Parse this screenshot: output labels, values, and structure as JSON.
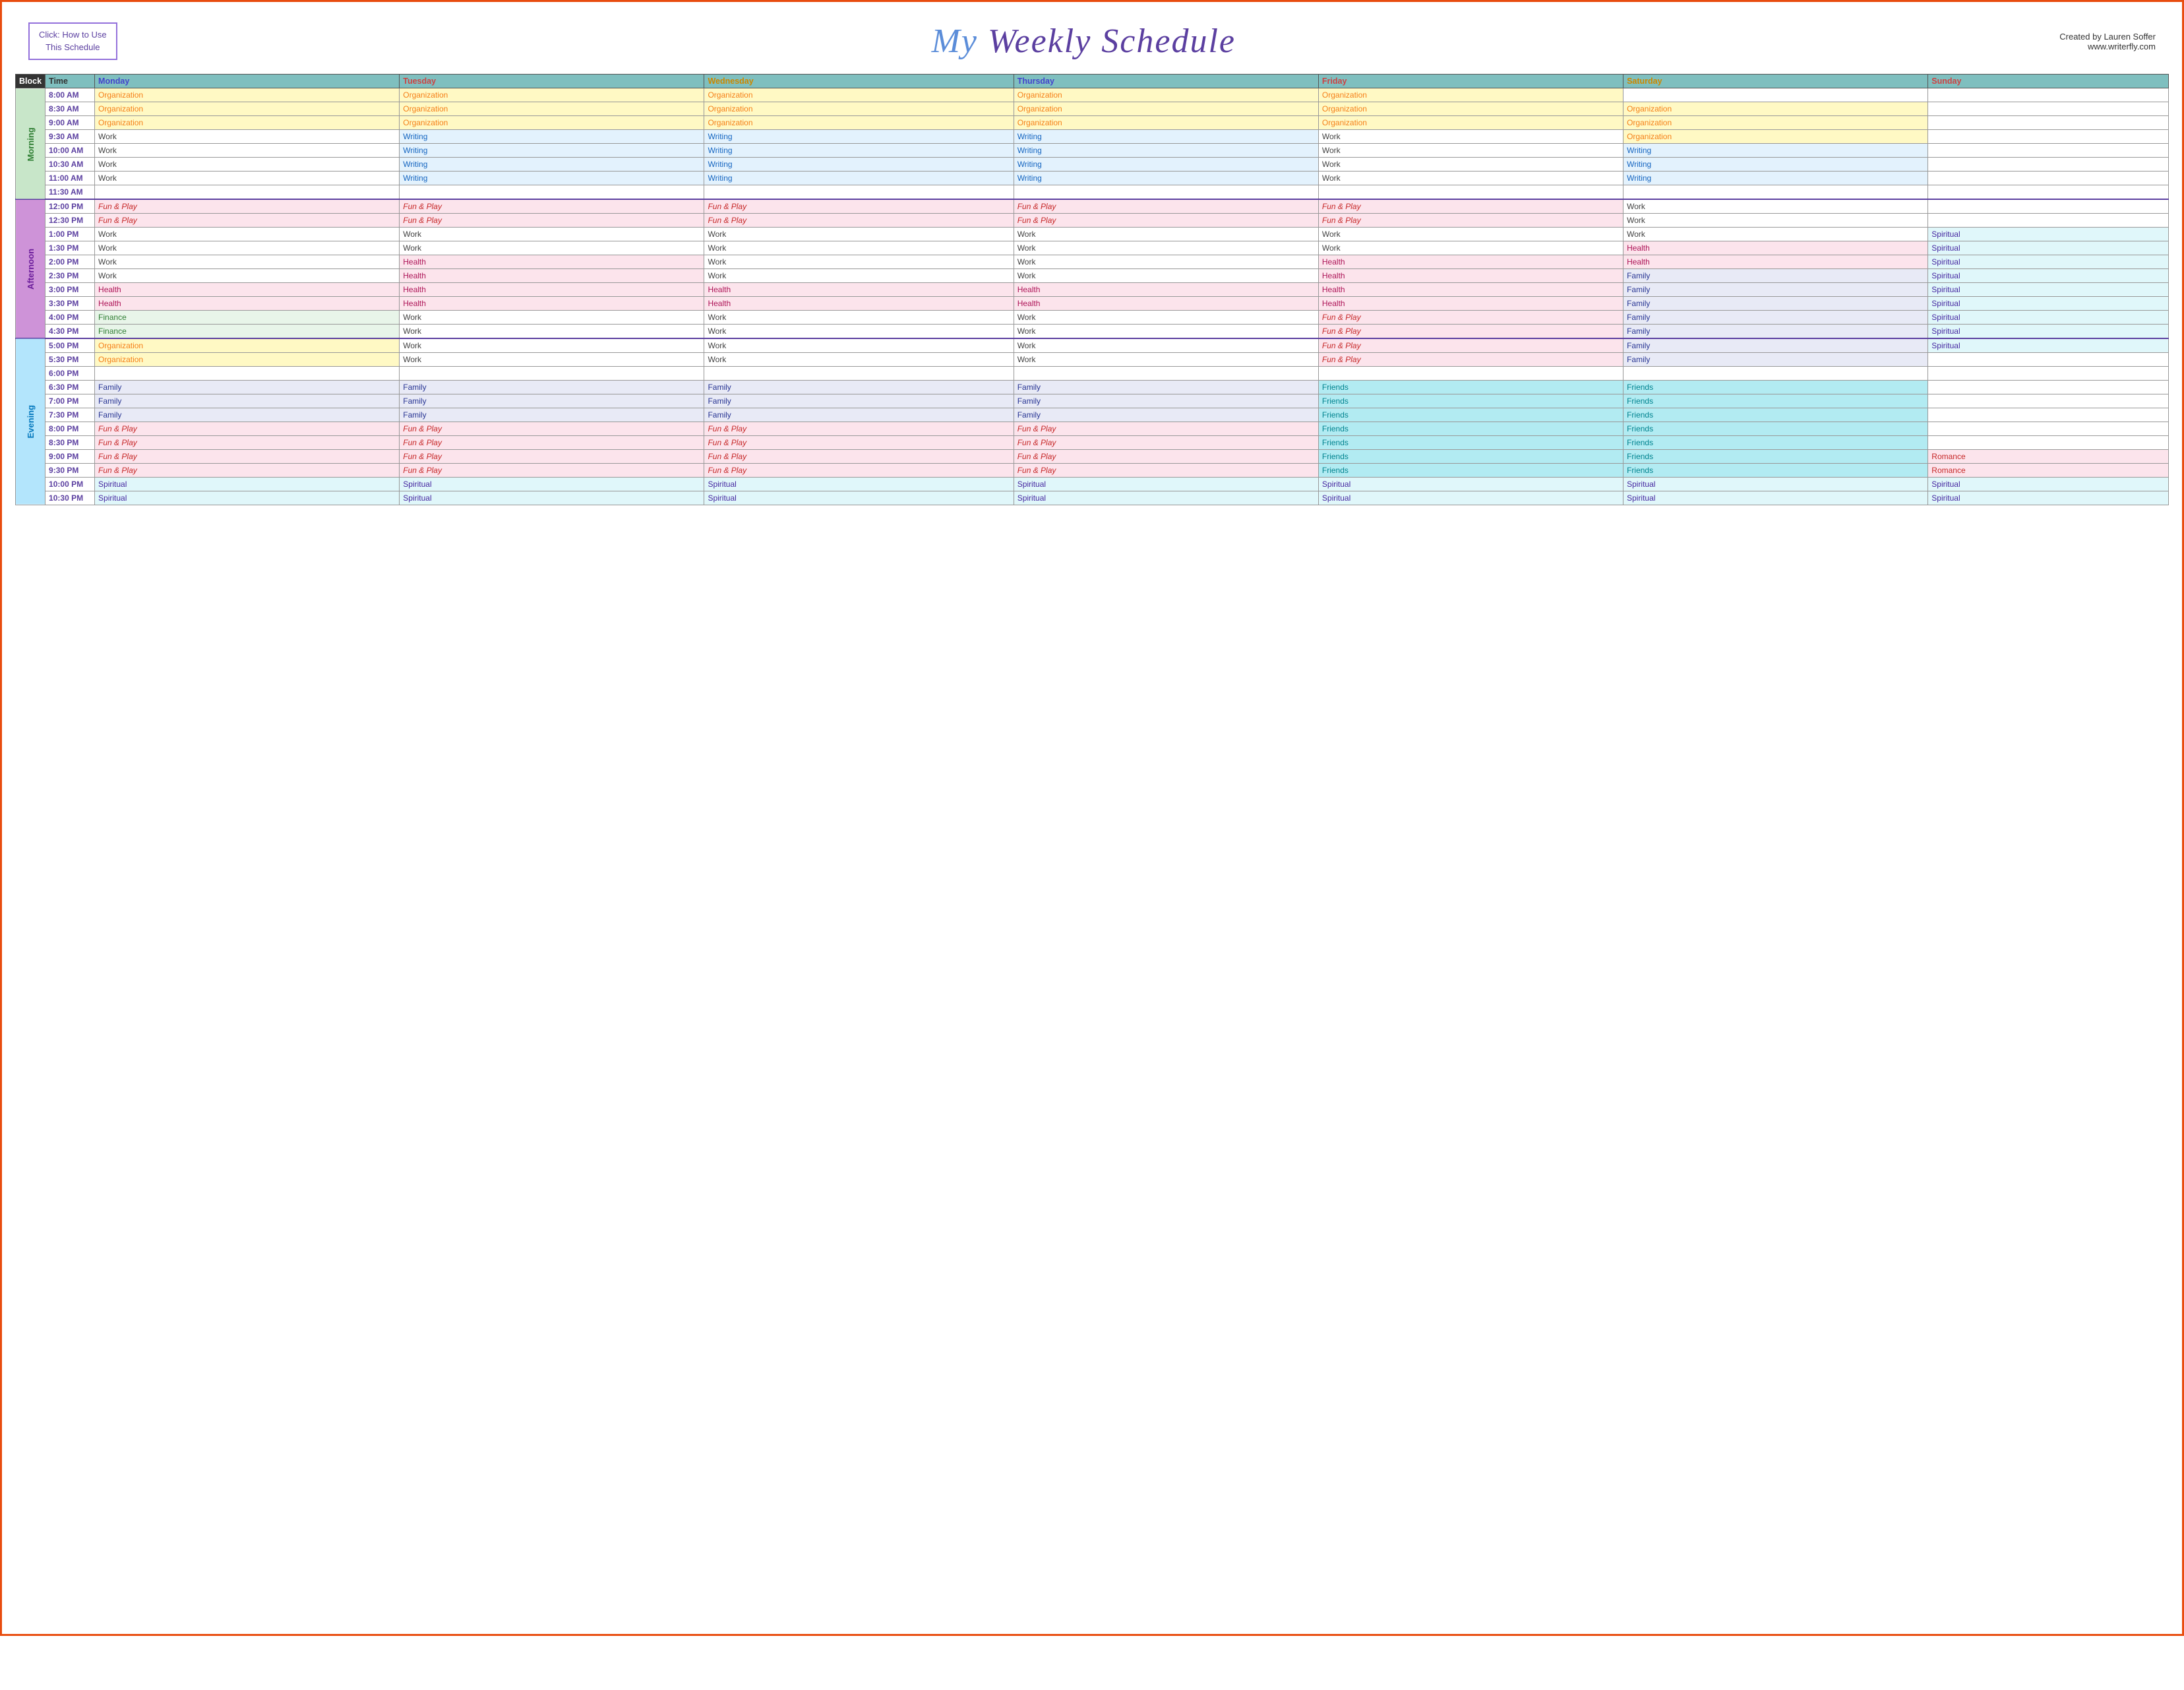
{
  "header": {
    "how_to_btn_line1": "Click:  How to Use",
    "how_to_btn_line2": "This Schedule",
    "title_my": "My",
    "title_rest": " Weekly Schedule",
    "creator_name": "Created by Lauren Soffer",
    "creator_url": "www.writerfly.com"
  },
  "table": {
    "headers": [
      "Block",
      "Time",
      "Monday",
      "Tuesday",
      "Wednesday",
      "Thursday",
      "Friday",
      "Saturday",
      "Sunday"
    ],
    "blocks": {
      "morning": "Morning",
      "afternoon": "Afternoon",
      "evening": "Evening"
    },
    "rows": [
      {
        "block": "morning",
        "time": "8:00 AM",
        "mon": "Organization",
        "tue": "Organization",
        "wed": "Organization",
        "thu": "Organization",
        "fri": "Organization",
        "sat": "",
        "sun": ""
      },
      {
        "block": "morning",
        "time": "8:30 AM",
        "mon": "Organization",
        "tue": "Organization",
        "wed": "Organization",
        "thu": "Organization",
        "fri": "Organization",
        "sat": "Organization",
        "sun": ""
      },
      {
        "block": "morning",
        "time": "9:00 AM",
        "mon": "Organization",
        "tue": "Organization",
        "wed": "Organization",
        "thu": "Organization",
        "fri": "Organization",
        "sat": "Organization",
        "sun": ""
      },
      {
        "block": "morning",
        "time": "9:30 AM",
        "mon": "Work",
        "tue": "Writing",
        "wed": "Writing",
        "thu": "Writing",
        "fri": "Work",
        "sat": "Organization",
        "sun": ""
      },
      {
        "block": "morning",
        "time": "10:00 AM",
        "mon": "Work",
        "tue": "Writing",
        "wed": "Writing",
        "thu": "Writing",
        "fri": "Work",
        "sat": "Writing",
        "sun": ""
      },
      {
        "block": "morning",
        "time": "10:30 AM",
        "mon": "Work",
        "tue": "Writing",
        "wed": "Writing",
        "thu": "Writing",
        "fri": "Work",
        "sat": "Writing",
        "sun": ""
      },
      {
        "block": "morning",
        "time": "11:00 AM",
        "mon": "Work",
        "tue": "Writing",
        "wed": "Writing",
        "thu": "Writing",
        "fri": "Work",
        "sat": "Writing",
        "sun": ""
      },
      {
        "block": "morning",
        "time": "11:30 AM",
        "mon": "",
        "tue": "",
        "wed": "",
        "thu": "",
        "fri": "",
        "sat": "",
        "sun": ""
      },
      {
        "block": "afternoon",
        "time": "12:00 PM",
        "mon": "Fun & Play",
        "tue": "Fun & Play",
        "wed": "Fun & Play",
        "thu": "Fun & Play",
        "fri": "Fun & Play",
        "sat": "Work",
        "sun": ""
      },
      {
        "block": "afternoon",
        "time": "12:30 PM",
        "mon": "Fun & Play",
        "tue": "Fun & Play",
        "wed": "Fun & Play",
        "thu": "Fun & Play",
        "fri": "Fun & Play",
        "sat": "Work",
        "sun": ""
      },
      {
        "block": "afternoon",
        "time": "1:00 PM",
        "mon": "Work",
        "tue": "Work",
        "wed": "Work",
        "thu": "Work",
        "fri": "Work",
        "sat": "Work",
        "sun": "Spiritual"
      },
      {
        "block": "afternoon",
        "time": "1:30 PM",
        "mon": "Work",
        "tue": "Work",
        "wed": "Work",
        "thu": "Work",
        "fri": "Work",
        "sat": "Health",
        "sun": "Spiritual"
      },
      {
        "block": "afternoon",
        "time": "2:00 PM",
        "mon": "Work",
        "tue": "Health",
        "wed": "Work",
        "thu": "Work",
        "fri": "Health",
        "sat": "Health",
        "sun": "Spiritual"
      },
      {
        "block": "afternoon",
        "time": "2:30 PM",
        "mon": "Work",
        "tue": "Health",
        "wed": "Work",
        "thu": "Work",
        "fri": "Health",
        "sat": "Family",
        "sun": "Spiritual"
      },
      {
        "block": "afternoon",
        "time": "3:00 PM",
        "mon": "Health",
        "tue": "Health",
        "wed": "Health",
        "thu": "Health",
        "fri": "Health",
        "sat": "Family",
        "sun": "Spiritual"
      },
      {
        "block": "afternoon",
        "time": "3:30 PM",
        "mon": "Health",
        "tue": "Health",
        "wed": "Health",
        "thu": "Health",
        "fri": "Health",
        "sat": "Family",
        "sun": "Spiritual"
      },
      {
        "block": "afternoon",
        "time": "4:00 PM",
        "mon": "Finance",
        "tue": "Work",
        "wed": "Work",
        "thu": "Work",
        "fri": "Fun & Play",
        "sat": "Family",
        "sun": "Spiritual"
      },
      {
        "block": "afternoon",
        "time": "4:30 PM",
        "mon": "Finance",
        "tue": "Work",
        "wed": "Work",
        "thu": "Work",
        "fri": "Fun & Play",
        "sat": "Family",
        "sun": "Spiritual"
      },
      {
        "block": "evening",
        "time": "5:00 PM",
        "mon": "Organization",
        "tue": "Work",
        "wed": "Work",
        "thu": "Work",
        "fri": "Fun & Play",
        "sat": "Family",
        "sun": "Spiritual"
      },
      {
        "block": "evening",
        "time": "5:30 PM",
        "mon": "Organization",
        "tue": "Work",
        "wed": "Work",
        "thu": "Work",
        "fri": "Fun & Play",
        "sat": "Family",
        "sun": ""
      },
      {
        "block": "evening",
        "time": "6:00 PM",
        "mon": "",
        "tue": "",
        "wed": "",
        "thu": "",
        "fri": "",
        "sat": "",
        "sun": ""
      },
      {
        "block": "evening",
        "time": "6:30 PM",
        "mon": "Family",
        "tue": "Family",
        "wed": "Family",
        "thu": "Family",
        "fri": "Friends",
        "sat": "Friends",
        "sun": ""
      },
      {
        "block": "evening",
        "time": "7:00 PM",
        "mon": "Family",
        "tue": "Family",
        "wed": "Family",
        "thu": "Family",
        "fri": "Friends",
        "sat": "Friends",
        "sun": ""
      },
      {
        "block": "evening",
        "time": "7:30 PM",
        "mon": "Family",
        "tue": "Family",
        "wed": "Family",
        "thu": "Family",
        "fri": "Friends",
        "sat": "Friends",
        "sun": ""
      },
      {
        "block": "evening",
        "time": "8:00 PM",
        "mon": "Fun & Play",
        "tue": "Fun & Play",
        "wed": "Fun & Play",
        "thu": "Fun & Play",
        "fri": "Friends",
        "sat": "Friends",
        "sun": ""
      },
      {
        "block": "evening",
        "time": "8:30 PM",
        "mon": "Fun & Play",
        "tue": "Fun & Play",
        "wed": "Fun & Play",
        "thu": "Fun & Play",
        "fri": "Friends",
        "sat": "Friends",
        "sun": ""
      },
      {
        "block": "evening",
        "time": "9:00 PM",
        "mon": "Fun & Play",
        "tue": "Fun & Play",
        "wed": "Fun & Play",
        "thu": "Fun & Play",
        "fri": "Friends",
        "sat": "Friends",
        "sun": "Romance"
      },
      {
        "block": "evening",
        "time": "9:30 PM",
        "mon": "Fun & Play",
        "tue": "Fun & Play",
        "wed": "Fun & Play",
        "thu": "Fun & Play",
        "fri": "Friends",
        "sat": "Friends",
        "sun": "Romance"
      },
      {
        "block": "evening",
        "time": "10:00 PM",
        "mon": "Spiritual",
        "tue": "Spiritual",
        "wed": "Spiritual",
        "thu": "Spiritual",
        "fri": "Spiritual",
        "sat": "Spiritual",
        "sun": "Spiritual"
      },
      {
        "block": "evening",
        "time": "10:30 PM",
        "mon": "Spiritual",
        "tue": "Spiritual",
        "wed": "Spiritual",
        "thu": "Spiritual",
        "fri": "Spiritual",
        "sat": "Spiritual",
        "sun": "Spiritual"
      }
    ]
  }
}
